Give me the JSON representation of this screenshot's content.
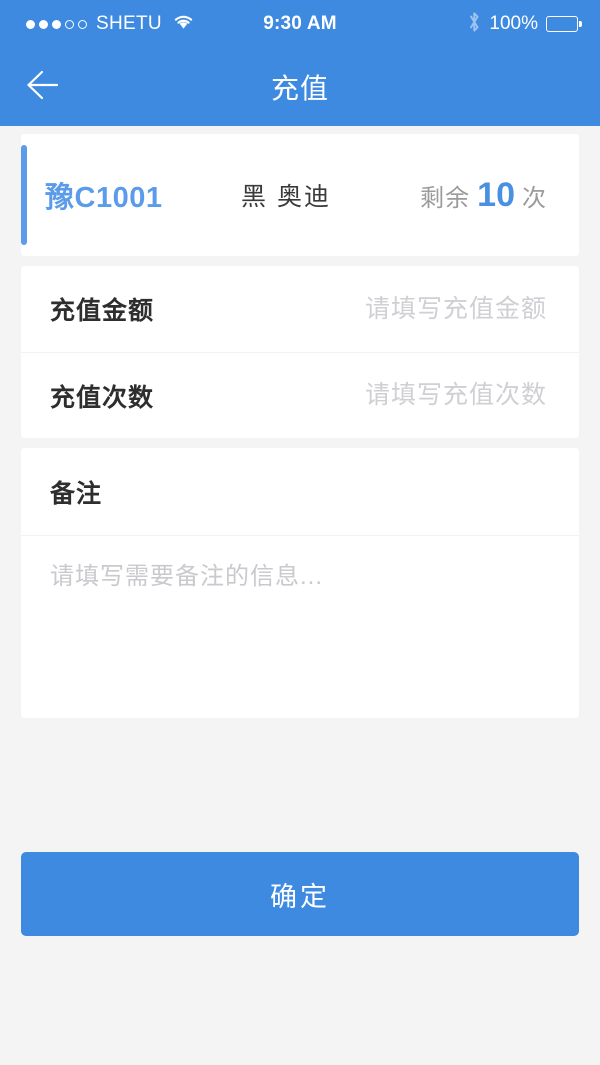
{
  "theme": {
    "brand_blue": "#3d8ae0",
    "accent_blue": "#5b9bea",
    "page_background": "#f4f4f5",
    "card_background": "#ffffff",
    "placeholder_gray": "#cfcfd4"
  },
  "status_bar": {
    "signal_dots_filled": 3,
    "signal_dots_total": 5,
    "carrier": "SHETU",
    "wifi_icon": "wifi-icon",
    "time": "9:30 AM",
    "bluetooth_icon": "bluetooth-icon",
    "battery_percent": "100%",
    "battery_icon": "battery-full-icon"
  },
  "nav_bar": {
    "back_icon": "back-arrow-icon",
    "title": "充值"
  },
  "vehicle": {
    "plate_number": "豫C1001",
    "description": "黑 奥迪",
    "remaining_label": "剩余",
    "remaining_count": "10",
    "remaining_unit": "次"
  },
  "form": {
    "rows": [
      {
        "label": "充值金额",
        "value": "",
        "placeholder": "请填写充值金额"
      },
      {
        "label": "充值次数",
        "value": "",
        "placeholder": "请填写充值次数"
      }
    ]
  },
  "remark": {
    "label": "备注",
    "value": "",
    "placeholder": "请填写需要备注的信息..."
  },
  "submit": {
    "label": "确定"
  }
}
